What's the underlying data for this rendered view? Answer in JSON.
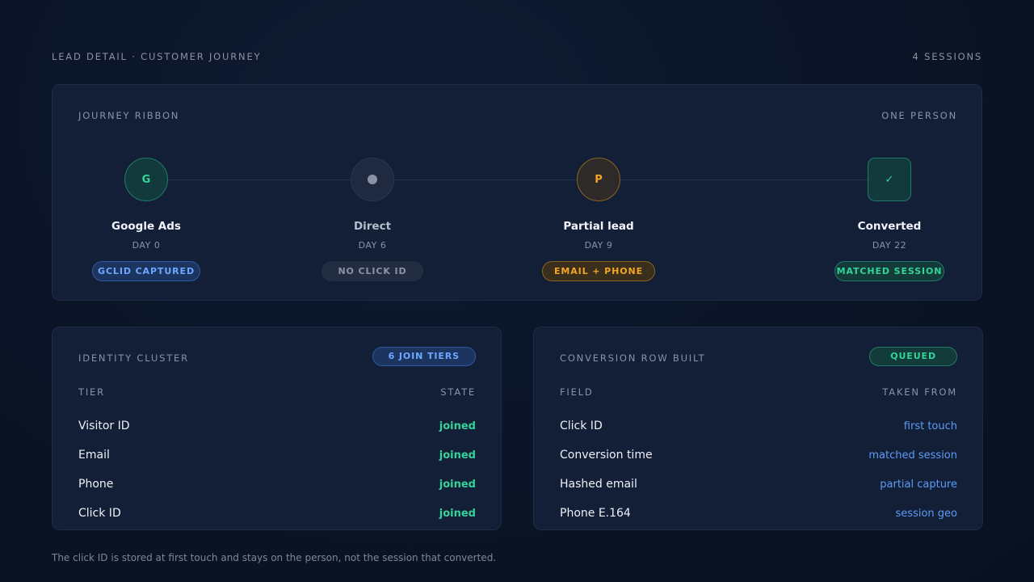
{
  "header": {
    "title": "LEAD DETAIL · CUSTOMER JOURNEY",
    "sessions": "4 SESSIONS"
  },
  "ribbon": {
    "title": "JOURNEY RIBBON",
    "subtitle": "ONE PERSON",
    "stages": [
      {
        "node": "G",
        "title": "Google Ads",
        "day": "DAY 0",
        "tag": "GCLID CAPTURED",
        "tone": "blue"
      },
      {
        "node": "",
        "title": "Direct",
        "day": "DAY 6",
        "tag": "NO CLICK ID",
        "tone": "grey"
      },
      {
        "node": "P",
        "title": "Partial lead",
        "day": "DAY 9",
        "tag": "EMAIL + PHONE",
        "tone": "amber"
      },
      {
        "node": "✓",
        "title": "Converted",
        "day": "DAY 22",
        "tag": "MATCHED SESSION",
        "tone": "green"
      }
    ]
  },
  "identity": {
    "title": "IDENTITY CLUSTER",
    "badge": "6 JOIN TIERS",
    "col_left": "TIER",
    "col_right": "STATE",
    "rows": [
      {
        "k": "Visitor ID",
        "v": "joined"
      },
      {
        "k": "Email",
        "v": "joined"
      },
      {
        "k": "Phone",
        "v": "joined"
      },
      {
        "k": "Click ID",
        "v": "joined"
      }
    ]
  },
  "conversion": {
    "title": "CONVERSION ROW BUILT",
    "badge": "QUEUED",
    "col_left": "FIELD",
    "col_right": "TAKEN FROM",
    "rows": [
      {
        "k": "Click ID",
        "v": "first touch"
      },
      {
        "k": "Conversion time",
        "v": "matched session"
      },
      {
        "k": "Hashed email",
        "v": "partial capture"
      },
      {
        "k": "Phone E.164",
        "v": "session geo"
      }
    ]
  },
  "footnote": "The click ID is stored at first touch and stays on the person, not the session that converted.",
  "colors": {
    "accent_green": "#34d399",
    "accent_blue": "#6ea8fe",
    "accent_amber": "#f5a524",
    "background": "#0b1426"
  }
}
